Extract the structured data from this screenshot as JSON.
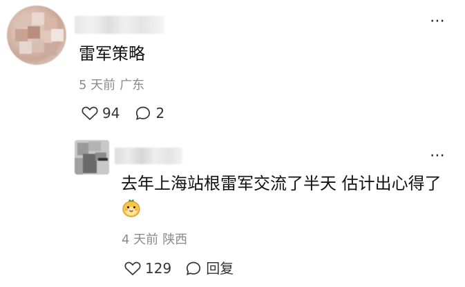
{
  "comments": [
    {
      "text": "雷军策略",
      "time": "5 天前",
      "location": "广东",
      "likes": "94",
      "replies": "2"
    },
    {
      "text": "去年上海站根雷军交流了半天 估计出心得了",
      "emoji": "emoji-icon",
      "time": "4 天前",
      "location": "陕西",
      "likes": "129",
      "reply_label": "回复"
    }
  ],
  "colors": {
    "text": "#111111",
    "meta": "#8a8a8a",
    "action": "#333333"
  }
}
